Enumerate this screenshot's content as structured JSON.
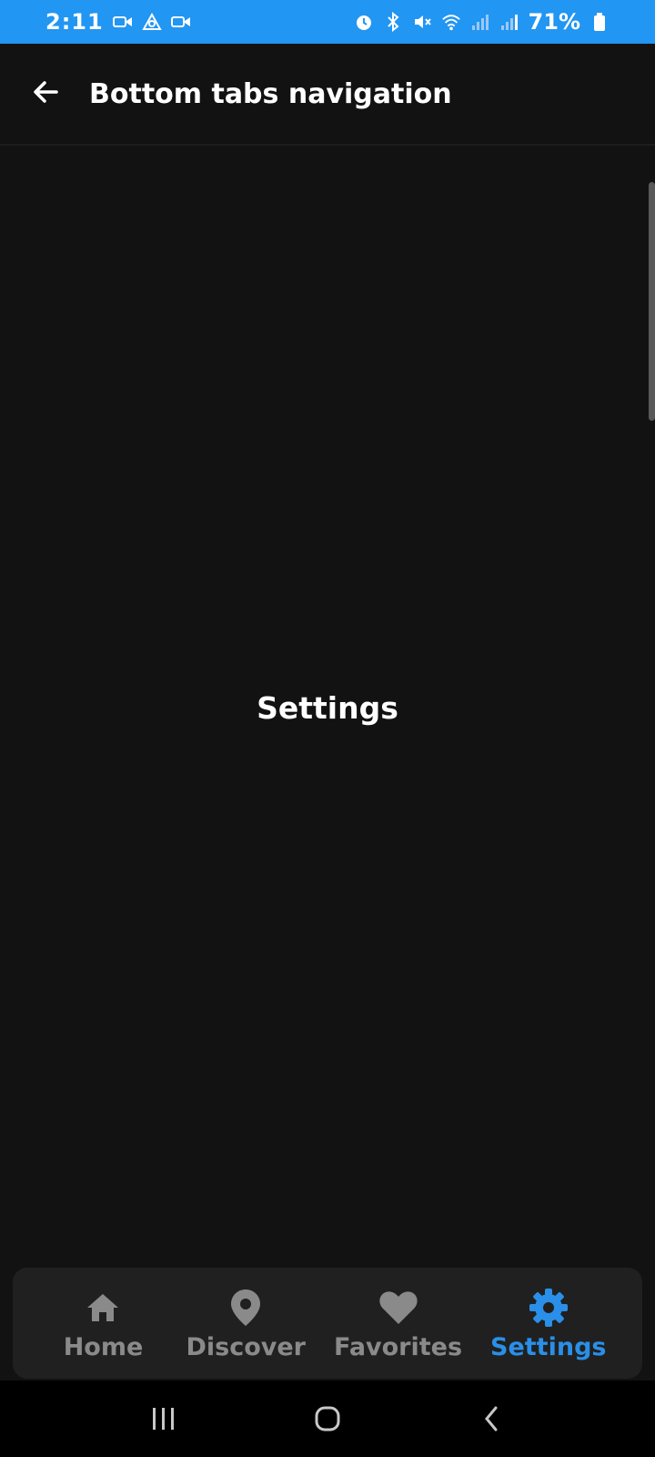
{
  "status_bar": {
    "time": "2:11",
    "battery": "71%",
    "background": "#2196f3",
    "left_icons": [
      "video-camera-icon",
      "app-triangle-icon",
      "video-camera-icon"
    ],
    "right_icons": [
      "alarm-icon",
      "bluetooth-icon",
      "mute-icon",
      "wifi-icon",
      "signal-icon",
      "signal-icon",
      "battery-icon"
    ]
  },
  "app_bar": {
    "title": "Bottom tabs navigation",
    "back_icon": "arrow-left-icon"
  },
  "content": {
    "label": "Settings"
  },
  "tabs": {
    "active_color": "#2a8fe8",
    "inactive_color": "#8a8a8a",
    "items": [
      {
        "label": "Home",
        "icon": "home-icon",
        "active": false
      },
      {
        "label": "Discover",
        "icon": "location-pin-icon",
        "active": false
      },
      {
        "label": "Favorites",
        "icon": "heart-icon",
        "active": false
      },
      {
        "label": "Settings",
        "icon": "gear-icon",
        "active": true
      }
    ]
  },
  "system_nav": {
    "items": [
      "recent-apps-icon",
      "home-circle-icon",
      "back-chevron-icon"
    ]
  }
}
